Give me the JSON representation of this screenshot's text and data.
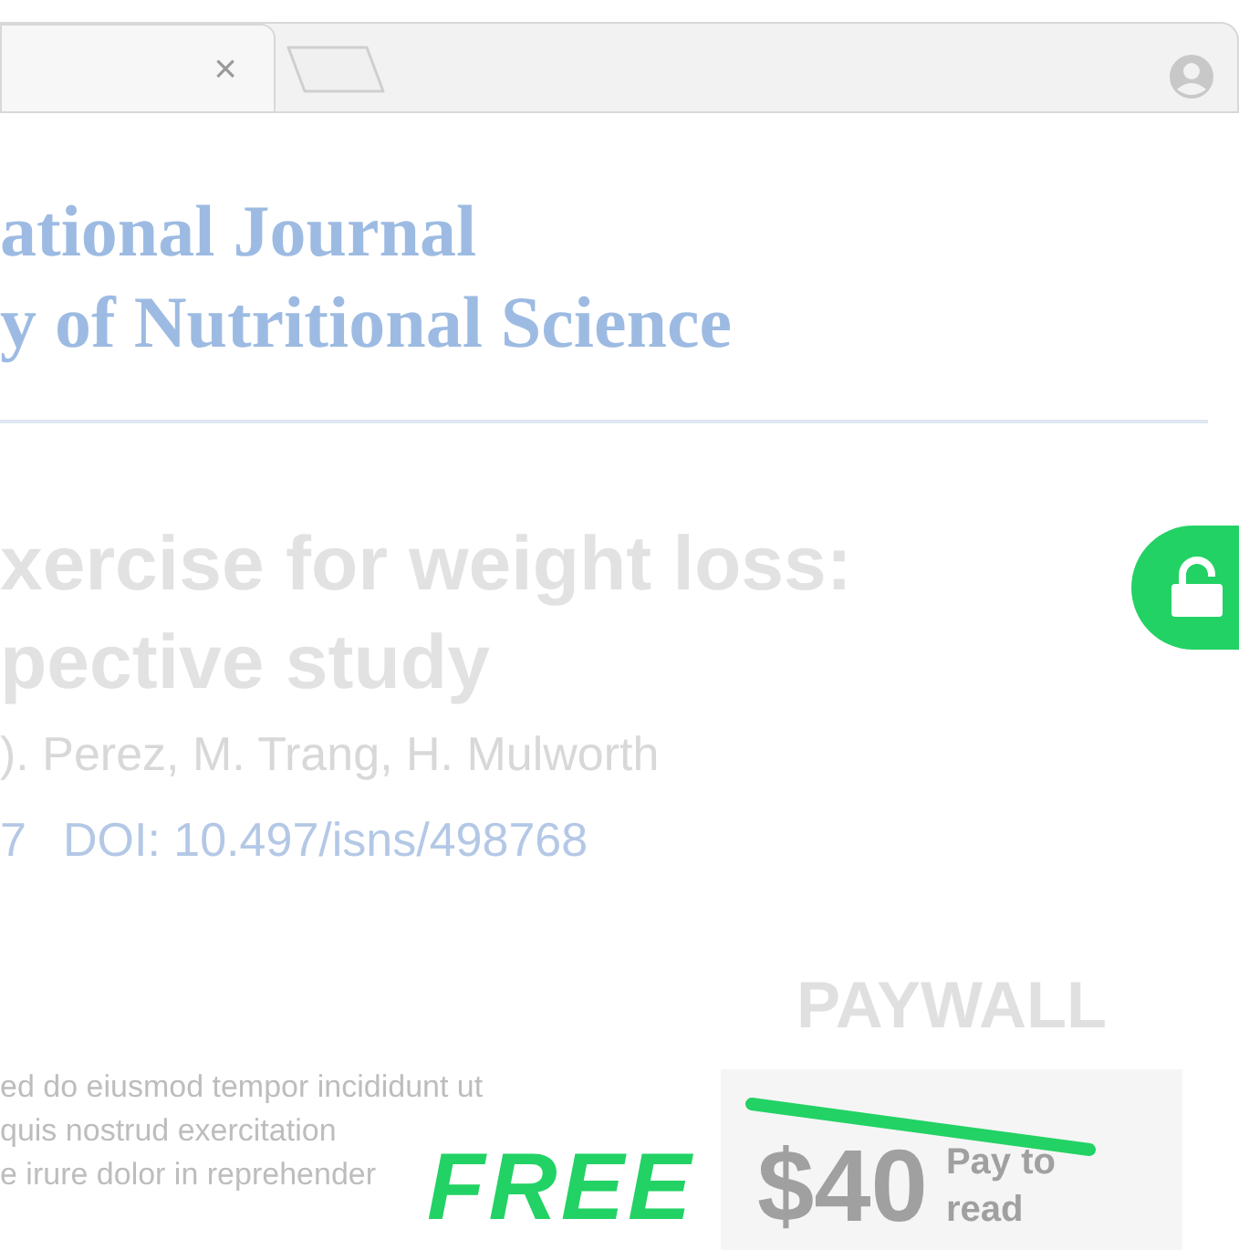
{
  "browser": {
    "tab_close": "×"
  },
  "journal": {
    "lines": [
      "ational Journal",
      "y of Nutritional Science"
    ]
  },
  "article": {
    "title_lines": [
      "xercise for weight loss:",
      "pective study"
    ],
    "authors": "). Perez, M. Trang, H. Mulworth",
    "year": "7",
    "doi": "DOI: 10.497/isns/498768"
  },
  "abstract_lines": [
    "ed do eiusmod tempor incididunt ut",
    "quis nostrud exercitation",
    "e irure dolor in reprehender"
  ],
  "paywall": {
    "heading": "PAYWALL",
    "price": "$40",
    "price_label_lines": [
      "Pay to",
      "read"
    ],
    "struck": true
  },
  "free_label": "FREE"
}
